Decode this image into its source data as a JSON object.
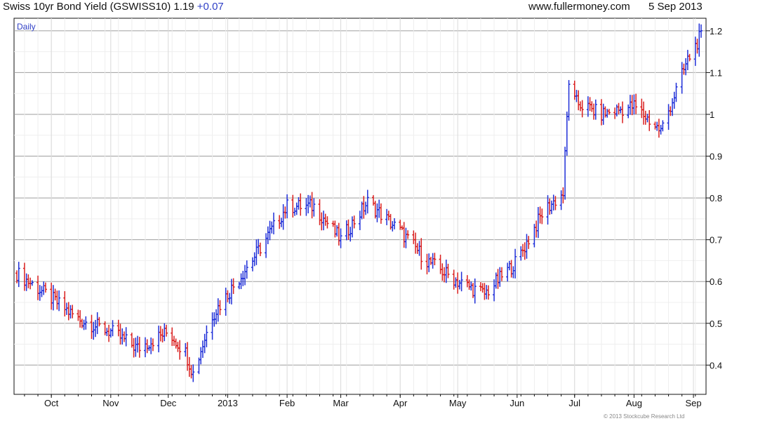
{
  "header": {
    "title": "Swiss 10yr Bond Yield (GSWISS10) 1.19",
    "change": "+0.07",
    "source": "www.fullermoney.com",
    "date": "5 Sep 2013"
  },
  "chart_data": {
    "type": "ohlc",
    "title": "Swiss 10yr Bond Yield (GSWISS10)",
    "frequency_label": "Daily",
    "last_value": 1.19,
    "change": 0.07,
    "x_label": "",
    "y_label": "",
    "ylim": [
      0.33,
      1.23
    ],
    "y_ticks": [
      0.4,
      0.5,
      0.6,
      0.7,
      0.8,
      0.9,
      1.0,
      1.1,
      1.2
    ],
    "y_tick_labels": [
      "0.4",
      "0.5",
      "0.6",
      "0.7",
      "0.8",
      "0.9",
      "1",
      "1.1",
      "1.2"
    ],
    "x_axis": {
      "months": [
        "Oct",
        "Nov",
        "Dec",
        "2013",
        "Feb",
        "Mar",
        "Apr",
        "May",
        "Jun",
        "Jul",
        "Aug",
        "Sep"
      ]
    },
    "grid": true,
    "series": [
      {
        "dates": [
          "2012-09-13",
          "2012-10-01",
          "2012-10-15",
          "2012-11-01",
          "2012-11-15",
          "2012-12-01",
          "2012-12-10",
          "2012-12-14",
          "2012-12-24",
          "2013-01-01",
          "2013-01-15",
          "2013-02-01",
          "2013-02-15",
          "2013-03-01",
          "2013-03-15",
          "2013-04-01",
          "2013-04-15",
          "2013-05-01",
          "2013-05-15",
          "2013-06-01",
          "2013-06-15",
          "2013-06-25",
          "2013-06-28",
          "2013-07-01",
          "2013-07-15",
          "2013-08-01",
          "2013-08-15",
          "2013-08-29",
          "2013-09-05"
        ],
        "values": [
          0.62,
          0.56,
          0.51,
          0.48,
          0.44,
          0.48,
          0.43,
          0.38,
          0.52,
          0.57,
          0.66,
          0.78,
          0.78,
          0.7,
          0.79,
          0.72,
          0.65,
          0.6,
          0.57,
          0.65,
          0.77,
          0.81,
          1.08,
          1.03,
          1.0,
          1.02,
          0.96,
          1.13,
          1.19
        ]
      }
    ],
    "watermark": "© 2013 Stockcube Research Ltd"
  },
  "colors": {
    "up_bar": "#1f2fd8",
    "down_bar": "#d91f1f",
    "grid": "#d9d9d9",
    "axis": "#111111",
    "accent": "#2f3fc6"
  }
}
